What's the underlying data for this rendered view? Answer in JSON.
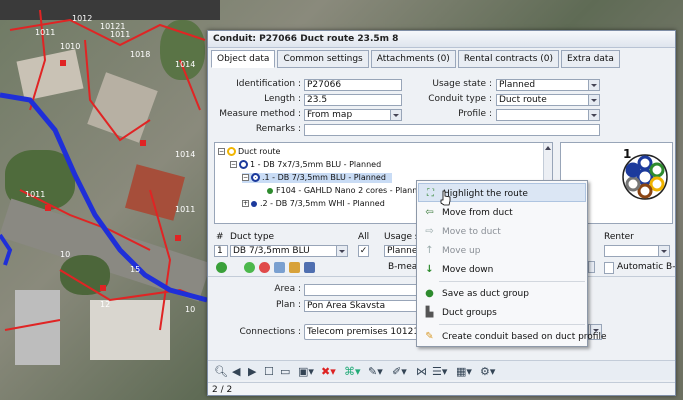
{
  "dialog": {
    "title": "Conduit: P27066 Duct route 23.5m 8",
    "tabs": [
      {
        "label": "Object data",
        "active": true
      },
      {
        "label": "Common settings",
        "active": false
      },
      {
        "label": "Attachments (0)",
        "active": false
      },
      {
        "label": "Rental contracts (0)",
        "active": false
      },
      {
        "label": "Extra data",
        "active": false
      }
    ],
    "form": {
      "identification_label": "Identification :",
      "identification_value": "P27066",
      "length_label": "Length :",
      "length_value": "23.5",
      "measure_method_label": "Measure method :",
      "measure_method_value": "From map",
      "remarks_label": "Remarks :",
      "remarks_value": "",
      "usage_state_label": "Usage state :",
      "usage_state_value": "Planned",
      "conduit_type_label": "Conduit type :",
      "conduit_type_value": "Duct route",
      "profile_label": "Profile :",
      "profile_value": ""
    },
    "tree": {
      "root": "Duct route",
      "n1": "1 - DB 7x7/3,5mm BLU - Planned",
      "n2": ".1 - DB 7/3,5mm BLU - Planned",
      "n3": "F104 - GAHLD Nano 2 cores - Planne",
      "n4": ".2 - DB 7/3,5mm WHI - Planned"
    },
    "profile_badge": "1",
    "table": {
      "col_num": "#",
      "col_duct_type": "Duct type",
      "col_all": "All",
      "col_usage": "Usage s",
      "col_renter": "Renter",
      "row_num": "1",
      "row_duct_type": "DB 7/3,5mm BLU",
      "row_usage": "Planne",
      "b_mea_label": "B-mea",
      "automatic_label": "Automatic B-r"
    },
    "area_label": "Area :",
    "area_value": "",
    "plan_label": "Plan :",
    "plan_value": "Pon Area Skavsta",
    "connections_label": "Connections :",
    "connections_value": "Telecom premises 10121",
    "status": "2 / 2"
  },
  "context_menu": {
    "items": [
      {
        "label": "Highlight the route",
        "state": "hover",
        "icon": "highlight-icon"
      },
      {
        "label": "Move from duct",
        "state": "enabled",
        "icon": "move-from-icon"
      },
      {
        "label": "Move to duct",
        "state": "disabled",
        "icon": "move-to-icon"
      },
      {
        "label": "Move up",
        "state": "disabled",
        "icon": "arrow-up-icon"
      },
      {
        "label": "Move down",
        "state": "enabled",
        "icon": "arrow-down-icon"
      },
      {
        "label": "Save as duct group",
        "state": "enabled",
        "icon": "save-group-icon"
      },
      {
        "label": "Duct groups",
        "state": "enabled",
        "icon": "duct-groups-icon"
      },
      {
        "label": "Create conduit based on duct profile",
        "state": "enabled",
        "icon": "create-conduit-icon"
      }
    ]
  },
  "map": {
    "labels": [
      "1012",
      "1011",
      "1011",
      "1010",
      "10121",
      "1018",
      "1014",
      "1014",
      "1011",
      "1011",
      "10",
      "15",
      "12",
      "10"
    ]
  },
  "colors": {
    "route": "#1f2fd8",
    "cable": "#e02424",
    "accent": "#f0b400"
  }
}
